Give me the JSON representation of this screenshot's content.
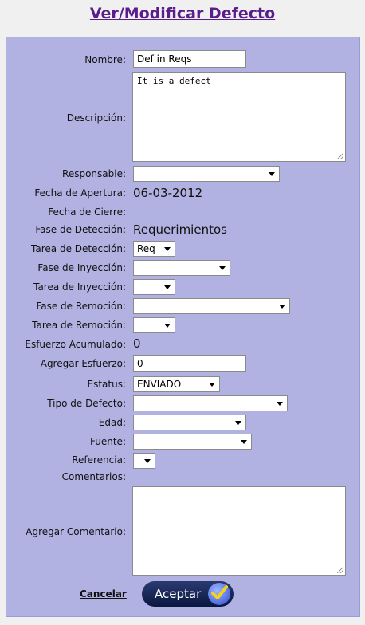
{
  "page": {
    "title": "Ver/Modificar Defecto"
  },
  "form": {
    "nombre_label": "Nombre:",
    "nombre_value": "Def in Reqs",
    "descripcion_label": "Descripción:",
    "descripcion_value": "It is a defect",
    "responsable_label": "Responsable:",
    "responsable_value": "",
    "fecha_apertura_label": "Fecha de Apertura:",
    "fecha_apertura_value": "06-03-2012",
    "fecha_cierre_label": "Fecha de Cierre:",
    "fecha_cierre_value": "",
    "fase_deteccion_label": "Fase de Detección:",
    "fase_deteccion_value": "Requerimientos",
    "tarea_deteccion_label": "Tarea de Detección:",
    "tarea_deteccion_value": "Req",
    "fase_inyeccion_label": "Fase de Inyección:",
    "fase_inyeccion_value": "",
    "tarea_inyeccion_label": "Tarea de Inyección:",
    "tarea_inyeccion_value": "",
    "fase_remocion_label": "Fase de Remoción:",
    "fase_remocion_value": "",
    "tarea_remocion_label": "Tarea de Remoción:",
    "tarea_remocion_value": "",
    "esfuerzo_acumulado_label": "Esfuerzo Acumulado:",
    "esfuerzo_acumulado_value": "0",
    "agregar_esfuerzo_label": "Agregar Esfuerzo:",
    "agregar_esfuerzo_value": "0",
    "estatus_label": "Estatus:",
    "estatus_value": "ENVIADO",
    "tipo_defecto_label": "Tipo de Defecto:",
    "tipo_defecto_value": "",
    "edad_label": "Edad:",
    "edad_value": "",
    "fuente_label": "Fuente:",
    "fuente_value": "",
    "referencia_label": "Referencia:",
    "referencia_value": "",
    "comentarios_label": "Comentarios:",
    "agregar_comentario_label": "Agregar Comentario:",
    "agregar_comentario_value": ""
  },
  "actions": {
    "cancel_label": "Cancelar",
    "accept_label": "Aceptar"
  },
  "colors": {
    "title": "#5a1e8c",
    "panel_bg": "#b1b2e2",
    "accept_bg": "#0b1740"
  },
  "icons": {
    "accept": "checkmark-icon",
    "select": "chevron-down-icon"
  }
}
